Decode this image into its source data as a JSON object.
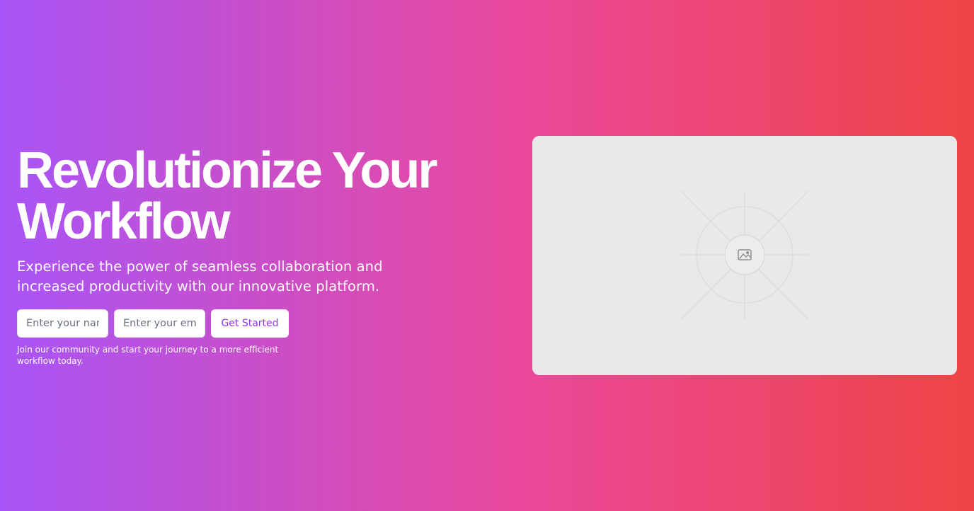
{
  "hero": {
    "headline": "Revolutionize Your Workflow",
    "subtitle": "Experience the power of seamless collaboration and increased productivity with our innovative platform.",
    "note": "Join our community and start your journey to a more efficient workflow today."
  },
  "form": {
    "name_placeholder": "Enter your name",
    "email_placeholder": "Enter your email",
    "submit_label": "Get Started"
  },
  "image": {
    "icon": "image-icon"
  },
  "colors": {
    "gradient_start": "#a855f7",
    "gradient_mid": "#ec4899",
    "gradient_end": "#ef4444",
    "button_text": "#9333ea",
    "placeholder_bg": "#e9e9e9"
  }
}
